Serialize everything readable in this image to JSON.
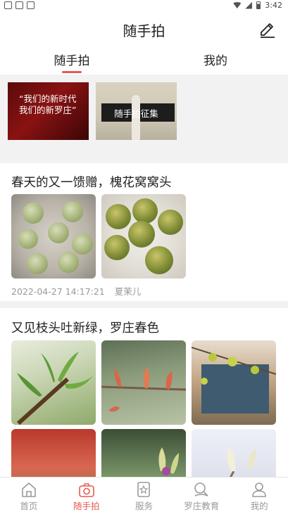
{
  "status_bar": {
    "time": "3:42"
  },
  "header": {
    "title": "随手拍",
    "edit_icon": "edit-pencil-icon"
  },
  "tabs": [
    {
      "label": "随手拍",
      "active": true
    },
    {
      "label": "我的",
      "active": false
    }
  ],
  "banners": [
    {
      "caption": "“我们的新时代 我们的新罗庄”"
    },
    {
      "caption": "随手拍征集"
    }
  ],
  "posts": [
    {
      "title": "春天的又一馈赠，槐花窝窝头",
      "date": "2022-04-27 14:17:21",
      "author": "夏茉儿",
      "images": [
        "steamed-buns-in-pan",
        "steamed-buns-on-plate"
      ]
    },
    {
      "title": "又见枝头吐新绿，罗庄春色",
      "images": [
        "green-leaf-buds",
        "red-flower-buds",
        "green-buds-window",
        "red-leaves",
        "purple-buds",
        "white-buds"
      ]
    }
  ],
  "colors": {
    "accent": "#e85a4f",
    "muted": "#999999",
    "divider": "#f2f2f2"
  },
  "navbar": {
    "items": [
      {
        "label": "首页",
        "icon": "home-icon",
        "active": false
      },
      {
        "label": "随手拍",
        "icon": "camera-icon",
        "active": true
      },
      {
        "label": "服务",
        "icon": "service-icon",
        "active": false
      },
      {
        "label": "罗庄教育",
        "icon": "education-icon",
        "active": false
      },
      {
        "label": "我的",
        "icon": "profile-icon",
        "active": false
      }
    ]
  }
}
